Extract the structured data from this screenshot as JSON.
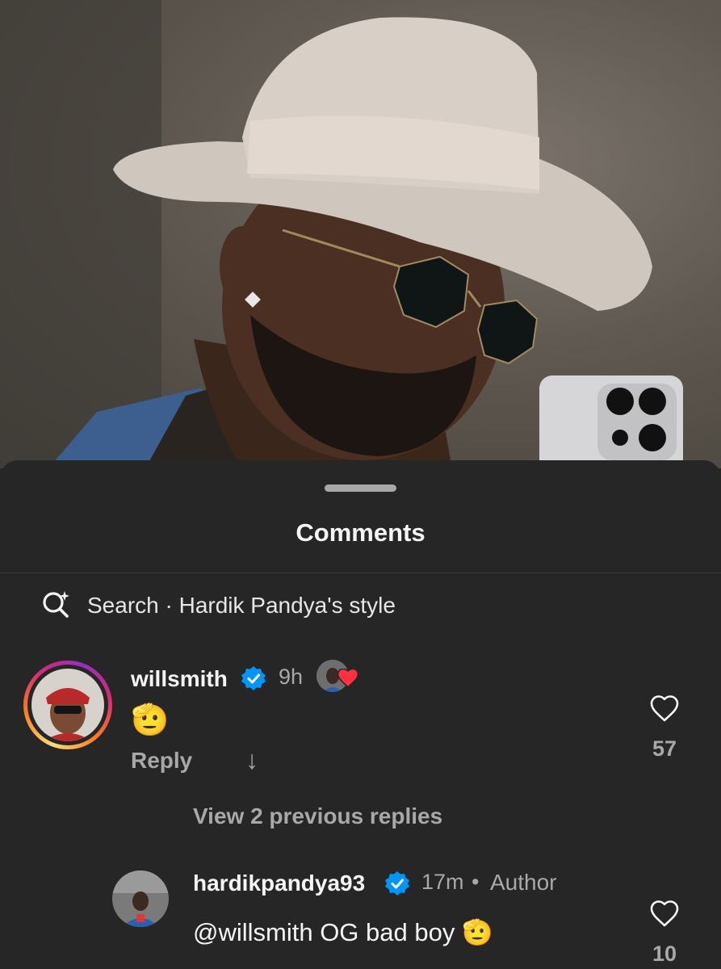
{
  "sheet": {
    "title": "Comments",
    "search_text": "Search · Hardik Pandya's style"
  },
  "comments": [
    {
      "username": "willsmith",
      "time": "9h",
      "text": "🫡",
      "reply_label": "Reply",
      "likes": "57"
    }
  ],
  "view_replies": "View 2 previous replies",
  "reply_comment": {
    "username": "hardikpandya93",
    "time": "17m",
    "separator": "•",
    "author_tag": "Author",
    "text": "@willsmith OG bad boy 🫡",
    "likes": "10"
  },
  "colors": {
    "sheet_bg": "#262626",
    "verified_blue": "#0095f6",
    "muted_text": "#a8a8a8",
    "heart_red": "#ff3040"
  }
}
